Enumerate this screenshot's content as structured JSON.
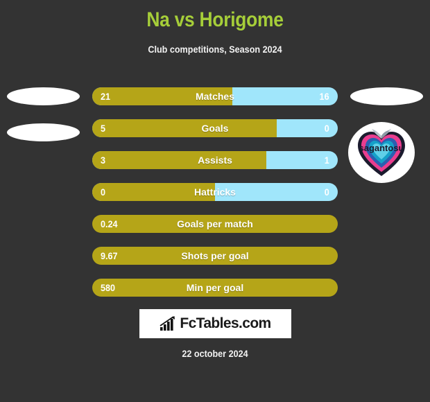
{
  "header": {
    "title": "Na vs Horigome",
    "subtitle": "Club competitions, Season 2024",
    "title_color": "#a6ce39"
  },
  "colors": {
    "background": "#333333",
    "home_bar": "#b5a518",
    "away_bar": "#a0e6fb",
    "text": "#ffffff"
  },
  "stats": [
    {
      "label": "Matches",
      "home": "21",
      "away": "16",
      "home_pct": 57,
      "has_away": true
    },
    {
      "label": "Goals",
      "home": "5",
      "away": "0",
      "home_pct": 75,
      "has_away": true
    },
    {
      "label": "Assists",
      "home": "3",
      "away": "1",
      "home_pct": 71,
      "has_away": true
    },
    {
      "label": "Hattricks",
      "home": "0",
      "away": "0",
      "home_pct": 50,
      "has_away": true
    },
    {
      "label": "Goals per match",
      "home": "0.24",
      "away": "",
      "home_pct": 100,
      "has_away": false
    },
    {
      "label": "Shots per goal",
      "home": "9.67",
      "away": "",
      "home_pct": 100,
      "has_away": false
    },
    {
      "label": "Min per goal",
      "home": "580",
      "away": "",
      "home_pct": 100,
      "has_away": false
    }
  ],
  "badge": {
    "club": "sagantosu",
    "text": "sagantosu"
  },
  "footer": {
    "logo_text": "FcTables.com",
    "date": "22 october 2024"
  }
}
